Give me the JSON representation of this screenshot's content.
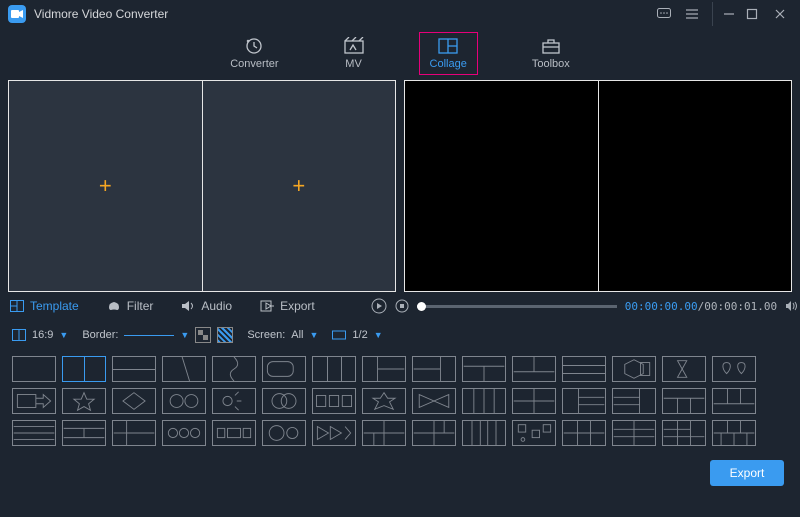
{
  "app": {
    "title": "Vidmore Video Converter"
  },
  "tabs": {
    "converter": "Converter",
    "mv": "MV",
    "collage": "Collage",
    "toolbox": "Toolbox"
  },
  "subTabs": {
    "template": "Template",
    "filter": "Filter",
    "audio": "Audio",
    "export": "Export"
  },
  "playback": {
    "current": "00:00:00.00",
    "duration": "00:00:01.00"
  },
  "options": {
    "aspect": "16:9",
    "borderLabel": "Border:",
    "screenLabel": "Screen:",
    "screenValue": "All",
    "splitValue": "1/2"
  },
  "footer": {
    "exportLabel": "Export"
  }
}
